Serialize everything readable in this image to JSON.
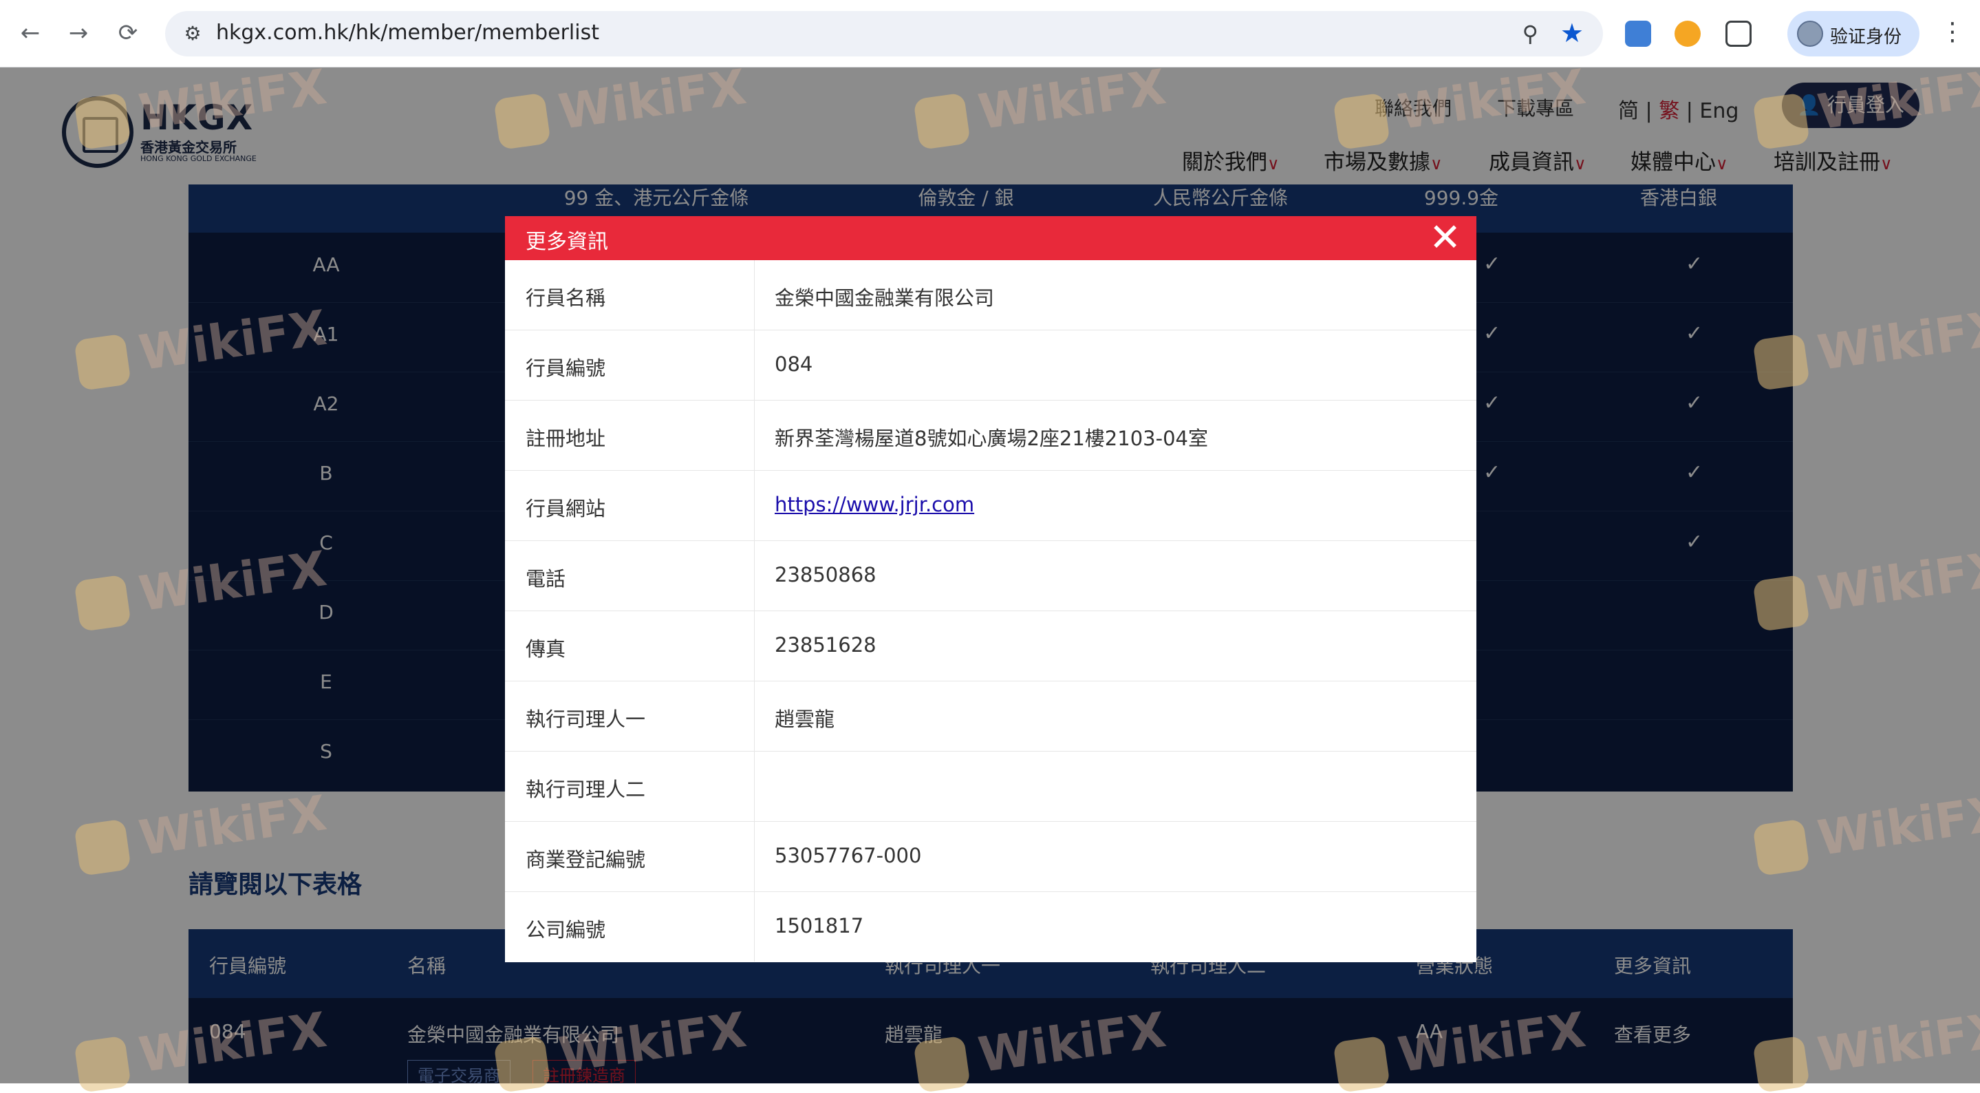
{
  "browser": {
    "url": "hkgx.com.hk/hk/member/memberlist",
    "profile_label": "验证身份"
  },
  "header": {
    "logo_text": "HKGX",
    "logo_sub": "香港黃金交易所",
    "logo_en": "HONG KONG GOLD EXCHANGE",
    "contact": "聯絡我們",
    "download": "下載專區",
    "lang_simplified": "简",
    "lang_traditional": "繁",
    "lang_english": "Eng",
    "lang_sep": "|",
    "login": "行員登入",
    "nav": [
      "關於我們",
      "市場及數據",
      "成員資訊",
      "媒體中心",
      "培訓及註冊"
    ]
  },
  "grade_table": {
    "columns": [
      "99 金、港元公斤金條",
      "倫敦金 / 銀",
      "人民幣公斤金條",
      "999.9金",
      "香港白銀"
    ],
    "rows": [
      {
        "grade": "AA",
        "c4": "✓",
        "c5": "✓"
      },
      {
        "grade": "A1",
        "c4": "✓",
        "c5": "✓"
      },
      {
        "grade": "A2",
        "c4": "✓",
        "c5": "✓"
      },
      {
        "grade": "B",
        "c4": "✓",
        "c5": "✓"
      },
      {
        "grade": "C",
        "c4": "",
        "c5": "✓"
      },
      {
        "grade": "D",
        "c4": "",
        "c5": ""
      },
      {
        "grade": "E",
        "c4": "",
        "c5": ""
      },
      {
        "grade": "S",
        "c4": "",
        "c5": ""
      }
    ]
  },
  "section_title": "請覽閱以下表格",
  "member_table": {
    "columns": [
      "行員編號",
      "名稱",
      "執行司理人一",
      "執行司理人二",
      "營業狀態",
      "更多資訊"
    ],
    "row": {
      "id": "084",
      "name": "金榮中國金融業有限公司",
      "manager1": "趙雲龍",
      "manager2": "",
      "status": "AA",
      "more": "查看更多",
      "tag1": "電子交易商",
      "tag2": "註冊鍊造商"
    }
  },
  "modal": {
    "title": "更多資訊",
    "rows": [
      {
        "label": "行員名稱",
        "value": "金榮中國金融業有限公司"
      },
      {
        "label": "行員編號",
        "value": "084"
      },
      {
        "label": "註冊地址",
        "value": "新界荃灣楊屋道8號如心廣場2座21樓2103-04室"
      },
      {
        "label": "行員網站",
        "value": "https://www.jrjr.com"
      },
      {
        "label": "電話",
        "value": "23850868"
      },
      {
        "label": "傳真",
        "value": "23851628"
      },
      {
        "label": "執行司理人一",
        "value": "趙雲龍"
      },
      {
        "label": "執行司理人二",
        "value": ""
      },
      {
        "label": "商業登記編號",
        "value": "53057767-000"
      },
      {
        "label": "公司編號",
        "value": "1501817"
      }
    ]
  },
  "watermark": "WikiFX",
  "colors": {
    "brand_navy": "#1f2a52",
    "table_header": "#173a78",
    "modal_header": "#e8293a",
    "accent_red": "#d51f35"
  }
}
